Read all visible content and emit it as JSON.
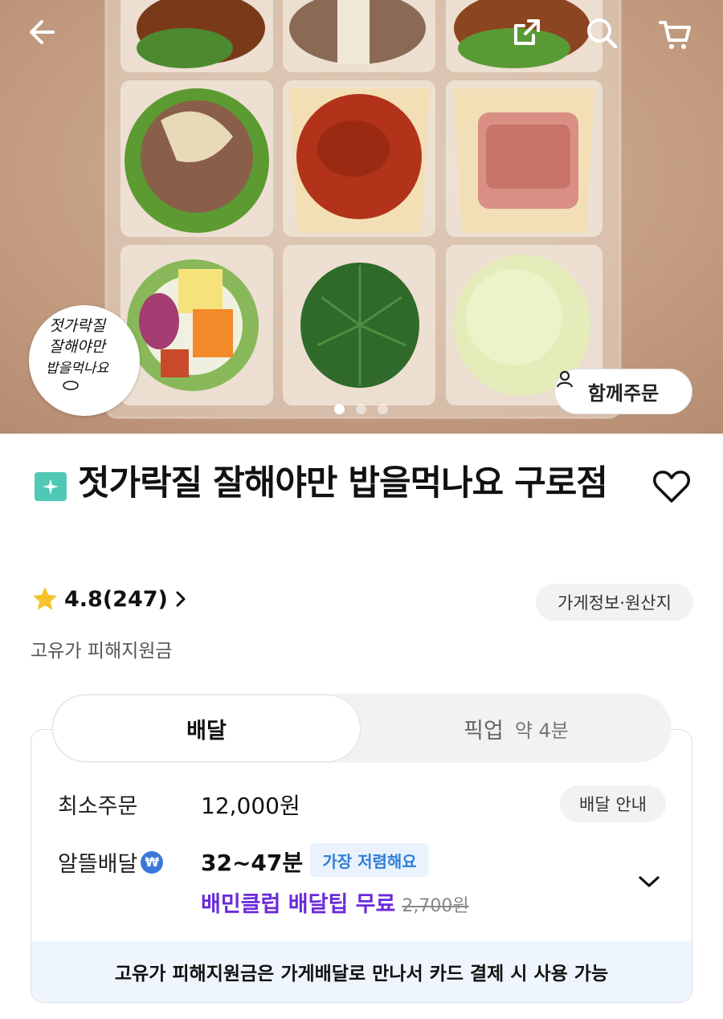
{
  "header": {
    "back_icon": "arrow-left-icon",
    "share_icon": "share-external-icon",
    "search_icon": "search-icon",
    "cart_icon": "cart-icon"
  },
  "hero": {
    "logo_text_line1": "젓가락질",
    "logo_text_line2": "잘해야만",
    "logo_text_line3": "밥을먹나요",
    "carousel": {
      "total": 3,
      "active": 1
    },
    "together_label": "함께주문"
  },
  "store": {
    "badge_color": "#4fc9b5",
    "title": "젓가락질 잘해야만 밥을먹나요 구로점",
    "rating_text": "4.8(247)",
    "info_label": "가게정보·원산지",
    "subsidy_text": "고유가 피해지원금"
  },
  "tabs": {
    "delivery_label": "배달",
    "pickup_label": "픽업",
    "pickup_eta": "약 4분"
  },
  "delivery": {
    "min_order_label": "최소주문",
    "min_order_value": "12,000원",
    "guide_label": "배달 안내",
    "saver_label": "알뜰배달",
    "saver_time": "32~47분",
    "cheapest_chip": "가장 저렴해요",
    "club_text": "배민클럽 배달팁 무료",
    "original_tip": "2,700원",
    "club_color": "#6a2bd9",
    "notice": "고유가 피해지원금은 가게배달로 만나서 카드 결제 시 사용 가능"
  }
}
